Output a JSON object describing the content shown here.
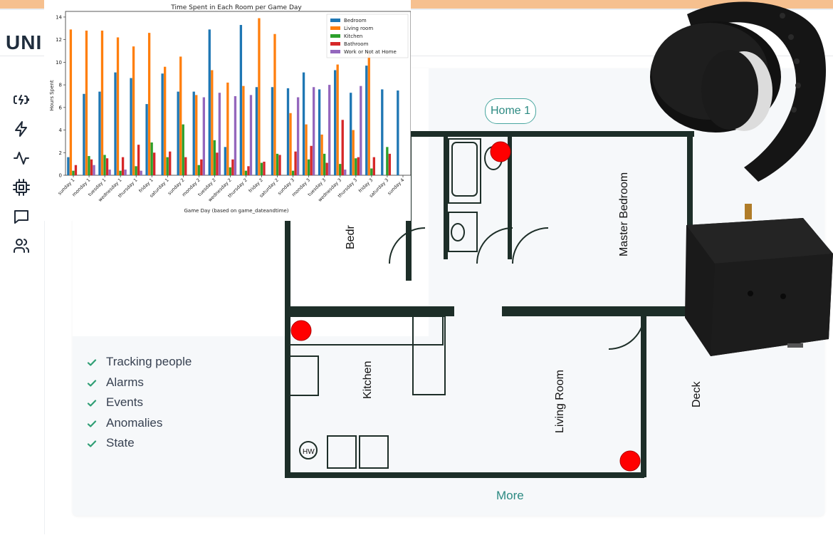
{
  "app": {
    "brand": "UNI"
  },
  "sidebar": {
    "items": [
      {
        "icon": "battery-charging-icon"
      },
      {
        "icon": "lightning-icon"
      },
      {
        "icon": "activity-icon"
      },
      {
        "icon": "chip-icon"
      },
      {
        "icon": "chat-icon"
      },
      {
        "icon": "users-icon"
      }
    ]
  },
  "home": {
    "label": "Home 1"
  },
  "features": [
    "Tracking people",
    "Alarms",
    "Events",
    "Anomalies",
    "State"
  ],
  "more_label": "More",
  "floorplan": {
    "rooms": {
      "bedroom": "Bedr",
      "master_bedroom": "Master Bedroom",
      "kitchen": "Kitchen",
      "living_room": "Living Room",
      "deck": "Deck",
      "hw": "HW"
    },
    "sensor_color": "#ff0000"
  },
  "colors": {
    "accent": "#2c8a82",
    "check": "#2f9e74"
  },
  "chart_data": {
    "type": "bar",
    "title": "Time Spent in Each Room per Game Day",
    "xlabel": "Game Day (based on game_dateandtime)",
    "ylabel": "Hours Spent",
    "ylim": [
      0,
      14.5
    ],
    "yticks": [
      0,
      2,
      4,
      6,
      8,
      10,
      12,
      14
    ],
    "legend_position": "top-right",
    "categories": [
      "sunday 1",
      "monday 1",
      "tuesday 1",
      "wednesday 1",
      "thursday 1",
      "friday 1",
      "saturday 1",
      "sunday 2",
      "monday 2",
      "tuesday 2",
      "wednesday 2",
      "thursday 2",
      "friday 2",
      "saturday 2",
      "sunday 3",
      "monday 3",
      "tuesday 3",
      "wednesday 3",
      "thursday 3",
      "friday 3",
      "saturday 3",
      "sunday 4"
    ],
    "series": [
      {
        "name": "Bedroom",
        "color": "#1f77b4",
        "values": [
          1.6,
          7.2,
          7.4,
          9.1,
          8.6,
          6.3,
          9.0,
          7.4,
          7.4,
          12.9,
          2.5,
          13.3,
          7.8,
          7.8,
          7.7,
          9.1,
          7.6,
          9.3,
          7.3,
          9.7,
          7.6,
          7.5
        ]
      },
      {
        "name": "Living room",
        "color": "#ff7f0e",
        "values": [
          12.9,
          12.8,
          12.8,
          12.2,
          11.4,
          12.6,
          9.6,
          10.5,
          7.1,
          9.3,
          8.2,
          7.9,
          13.9,
          12.5,
          5.5,
          4.5,
          3.6,
          9.8,
          4.0,
          10.8,
          0,
          0
        ]
      },
      {
        "name": "Kitchen",
        "color": "#2ca02c",
        "values": [
          0.4,
          1.7,
          1.8,
          0.4,
          0.8,
          2.9,
          1.6,
          4.5,
          0.9,
          3.1,
          0.7,
          0.4,
          1.1,
          1.9,
          0.4,
          1.4,
          1.9,
          1.0,
          1.5,
          0.6,
          2.5,
          0
        ]
      },
      {
        "name": "Bathroom",
        "color": "#d62728",
        "values": [
          0.9,
          1.4,
          1.5,
          1.6,
          2.7,
          2.0,
          2.1,
          1.6,
          1.4,
          2.0,
          1.4,
          0.8,
          1.2,
          1.8,
          2.1,
          2.6,
          1.1,
          4.9,
          1.6,
          1.6,
          1.9,
          0
        ]
      },
      {
        "name": "Work or Not at Home",
        "color": "#9467bd",
        "values": [
          0,
          0.9,
          0.5,
          0.5,
          0.4,
          0,
          0,
          0,
          6.9,
          7.3,
          7.0,
          7.1,
          0,
          0,
          6.9,
          7.8,
          8.0,
          0.5,
          7.9,
          0,
          0,
          0
        ]
      }
    ]
  }
}
